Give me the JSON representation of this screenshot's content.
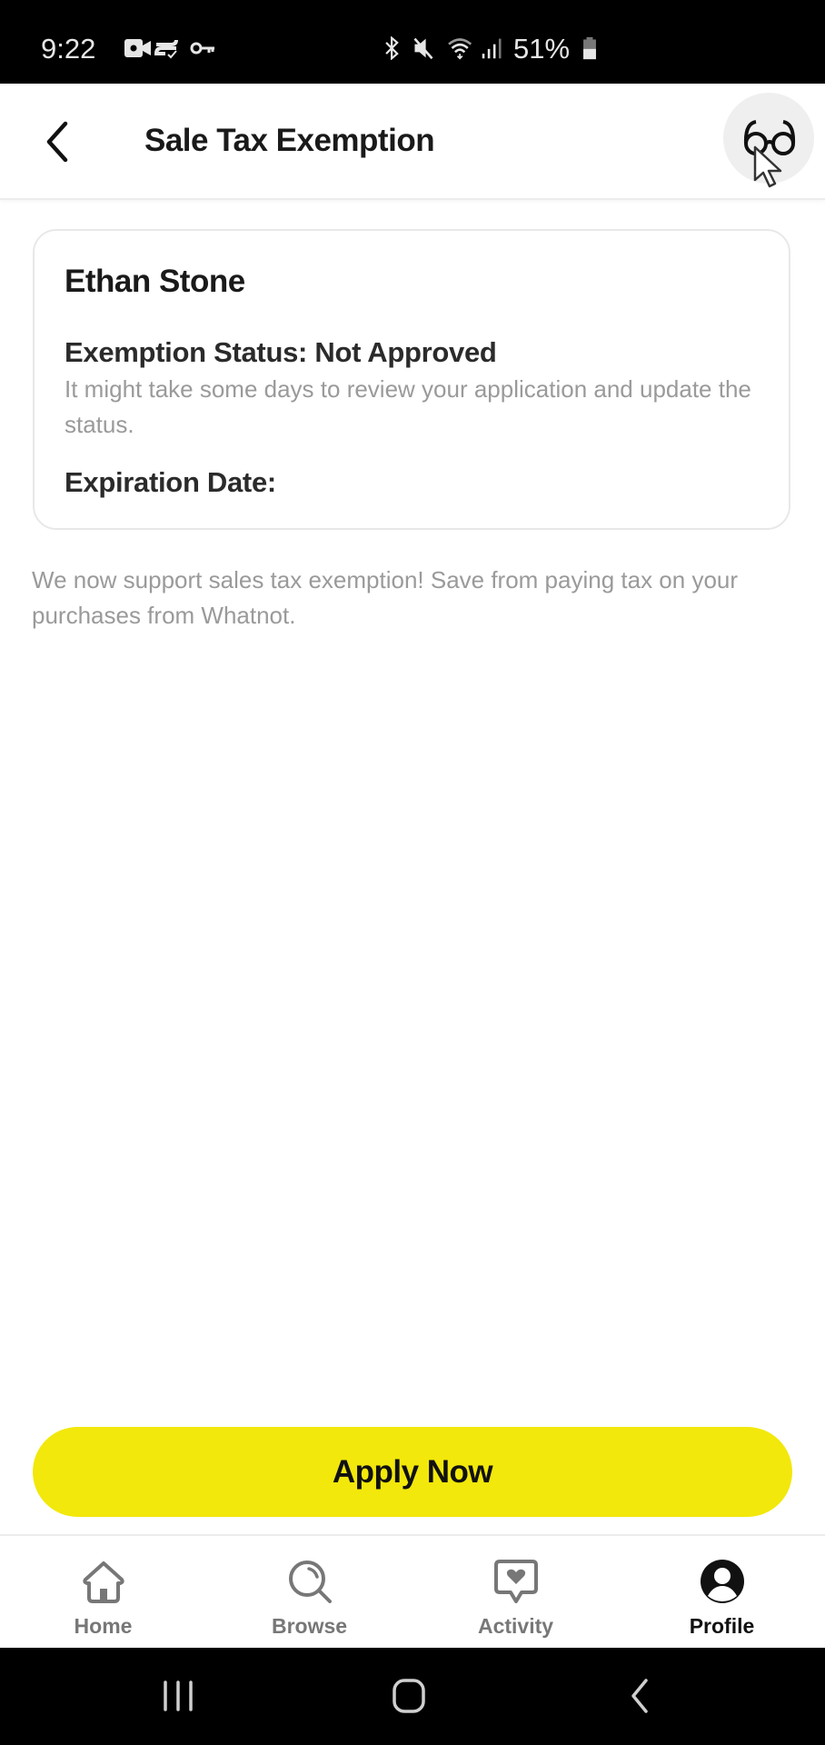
{
  "status_bar": {
    "time": "9:22",
    "left_icons": [
      "video-camera-icon",
      "cast-icon",
      "vpn-key-icon"
    ],
    "right_icons": [
      "bluetooth-icon",
      "mute-icon",
      "wifi-icon",
      "signal-icon"
    ],
    "battery": "51%"
  },
  "header": {
    "title": "Sale Tax Exemption",
    "back_icon": "chevron-left-icon",
    "action_icon": "glasses-icon"
  },
  "card": {
    "name": "Ethan Stone",
    "status_label": "Exemption Status: Not Approved",
    "status_note": "It might take some days to review your application and update the status.",
    "expiration_label": "Expiration Date:"
  },
  "description": "We now support sales tax exemption! Save from paying tax on your purchases from Whatnot.",
  "apply_button": {
    "label": "Apply Now",
    "color": "#f2e80b"
  },
  "bottom_nav": {
    "items": [
      {
        "label": "Home",
        "icon": "home-icon",
        "active": false
      },
      {
        "label": "Browse",
        "icon": "search-icon",
        "active": false
      },
      {
        "label": "Activity",
        "icon": "activity-heart-icon",
        "active": false
      },
      {
        "label": "Profile",
        "icon": "profile-icon",
        "active": true
      }
    ]
  },
  "android_nav": {
    "buttons": [
      "recent-apps-icon",
      "home-circle-icon",
      "back-icon"
    ]
  }
}
